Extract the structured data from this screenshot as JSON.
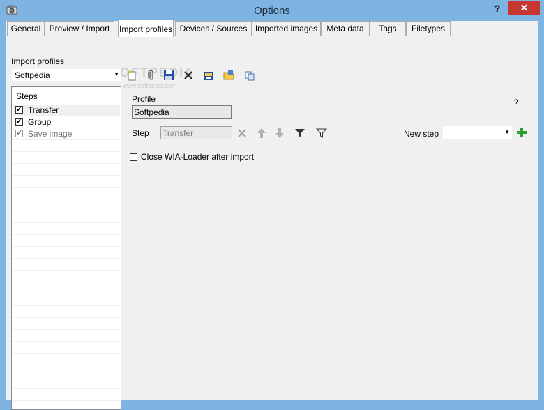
{
  "window": {
    "title": "Options",
    "help_label": "?",
    "close_label": "✕"
  },
  "tabs": [
    {
      "label": "General"
    },
    {
      "label": "Preview / Import"
    },
    {
      "label": "Import profiles"
    },
    {
      "label": "Devices / Sources"
    },
    {
      "label": "Imported images"
    },
    {
      "label": "Meta data"
    },
    {
      "label": "Tags"
    },
    {
      "label": "Filetypes"
    }
  ],
  "import_profiles": {
    "label": "Import profiles",
    "selected": "Softpedia",
    "toolbar_icons": [
      "new-profile-icon",
      "attach-icon",
      "save-icon",
      "delete-icon",
      "export-icon",
      "open-folder-icon",
      "copy-icon"
    ]
  },
  "steps": {
    "header": "Steps",
    "items": [
      {
        "label": "Transfer",
        "checked": true,
        "enabled": true
      },
      {
        "label": "Group",
        "checked": true,
        "enabled": true
      },
      {
        "label": "Save image",
        "checked": true,
        "enabled": false
      }
    ]
  },
  "profile": {
    "label": "Profile",
    "name": "Softpedia",
    "help": "?"
  },
  "step_editor": {
    "label": "Step",
    "value": "Transfer",
    "actions": [
      "remove-step-icon",
      "move-up-icon",
      "move-down-icon",
      "filter-icon",
      "clear-filter-icon"
    ],
    "new_step_label": "New step",
    "new_step_value": ""
  },
  "options": {
    "close_after_import_label": "Close WIA-Loader after import",
    "close_after_import_checked": false
  },
  "watermark": {
    "line1": "SOFTPEDIA",
    "line2": "www.softpedia.com"
  }
}
